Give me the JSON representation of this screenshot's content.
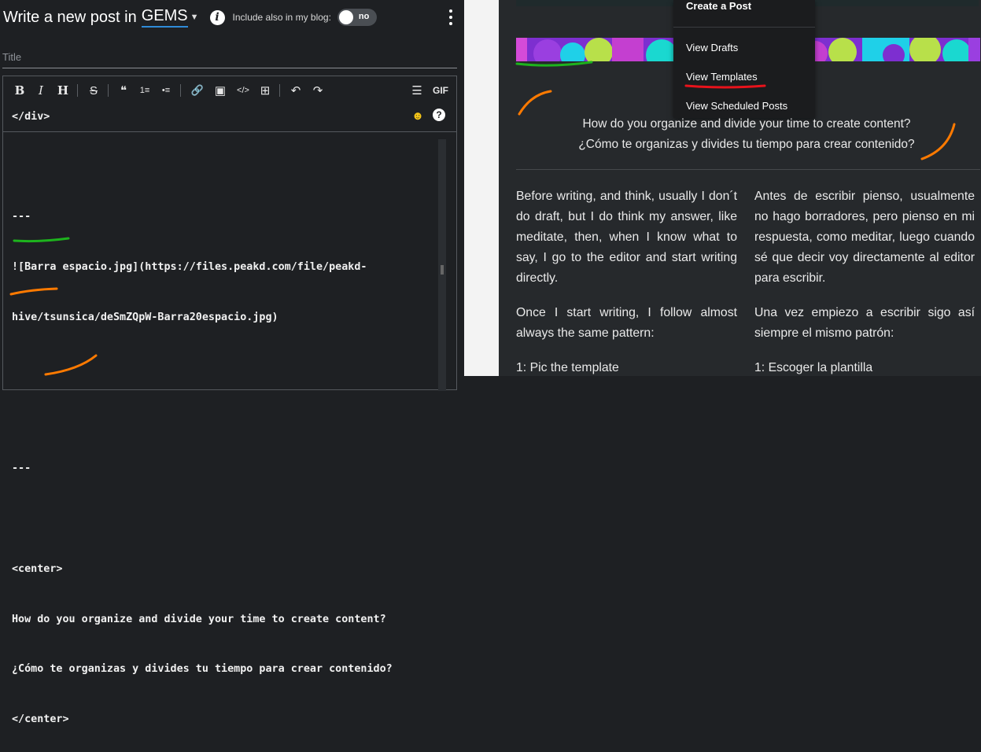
{
  "editor_header": {
    "title_prefix": "Write a new post in",
    "community": "GEMS",
    "include_label": "Include also in my blog:",
    "toggle_value": "no"
  },
  "title_field": {
    "placeholder": "Title",
    "value": ""
  },
  "toolbar": {
    "bold": "B",
    "italic": "I",
    "heading": "H",
    "strike": "S",
    "quote": "❝",
    "ol": "1≡",
    "ul": "•≡",
    "link": "🔗",
    "image": "▣",
    "code": "</>",
    "table": "⊞",
    "undo": "↶",
    "redo": "↷",
    "snippets": "☰",
    "gif": "GIF",
    "emoji": "☻",
    "help": "?"
  },
  "code_lines": [
    "</div>",
    "",
    "---",
    "![Barra espacio.jpg](https://files.peakd.com/file/peakd-",
    "hive/tsunsica/deSmZQpW-Barra20espacio.jpg)",
    "",
    "",
    "---",
    "",
    "<center>",
    "How do you organize and divide your time to create content?",
    "¿Cómo te organizas y divides tu tiempo para crear contenido?",
    "</center>"
  ],
  "menu": {
    "create_post": "Create a Post",
    "view_drafts": "View Drafts",
    "view_templates": "View Templates",
    "view_scheduled": "View Scheduled Posts"
  },
  "preview": {
    "center_en": "How do you organize and divide your time to create content?",
    "center_es": "¿Cómo te organizas y divides tu tiempo para crear contenido?",
    "col_en": [
      "Before writing, and think, usually I don´t do draft, but I do think my answer, like meditate, then, when I know what to say, I go to the editor and start writing directly.",
      "Once I start writing, I follow almost always the same pattern:",
      "1: Pic the template"
    ],
    "col_es": [
      "Antes de escribir pienso, usualmente no hago borradores, pero pienso en mi respuesta, como meditar, luego cuando sé que decir voy directamente al editor para escribir.",
      "Una vez empiezo a escribir sigo así siempre el mismo patrón:",
      "1: Escoger la plantilla"
    ]
  },
  "colors": {
    "background": "#1e2023",
    "preview_bg": "#26292c",
    "accent_blue": "#2f8bd8",
    "annotation_green": "#1db31d",
    "annotation_orange": "#ff7a00",
    "annotation_red": "#e8121b"
  }
}
